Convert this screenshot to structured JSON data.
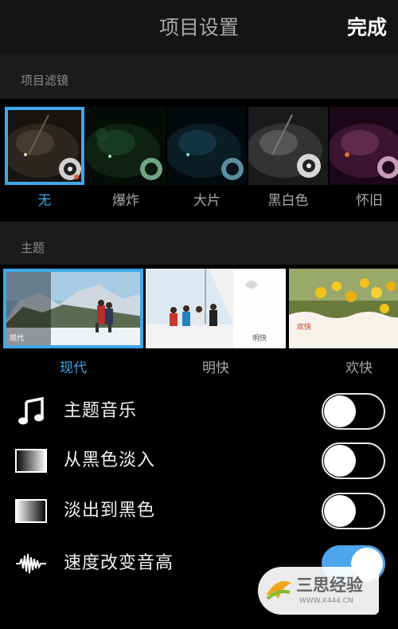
{
  "navbar": {
    "title": "项目设置",
    "done": "完成"
  },
  "filters": {
    "header": "项目滤镜",
    "items": [
      {
        "label": "无",
        "selected": true
      },
      {
        "label": "爆炸",
        "selected": false
      },
      {
        "label": "大片",
        "selected": false
      },
      {
        "label": "黑白色",
        "selected": false
      },
      {
        "label": "怀旧",
        "selected": false
      }
    ]
  },
  "themes": {
    "header": "主题",
    "items": [
      {
        "label": "现代",
        "tag": "现代",
        "selected": true
      },
      {
        "label": "明快",
        "tag": "明快",
        "selected": false
      },
      {
        "label": "欢快",
        "tag": "欢快",
        "selected": false
      }
    ]
  },
  "settings": [
    {
      "label": "主题音乐",
      "icon": "music-note-icon",
      "on": false
    },
    {
      "label": "从黑色淡入",
      "icon": "fade-in-icon",
      "on": false
    },
    {
      "label": "淡出到黑色",
      "icon": "fade-out-icon",
      "on": false
    },
    {
      "label": "速度改变音高",
      "icon": "waveform-icon",
      "on": true
    }
  ],
  "watermark": {
    "text": "三思经验",
    "url": "WWW.X444.CN"
  },
  "colors": {
    "accent": "#3ea8ea",
    "switch_on": "#4da6ee",
    "navbar": "#141414",
    "section": "#1b1b1b"
  }
}
